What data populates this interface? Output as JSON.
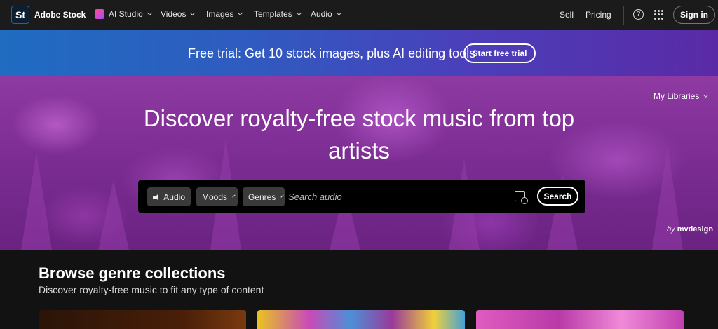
{
  "nav": {
    "logo": "St",
    "brand": "Adobe Stock",
    "items": [
      {
        "label": "AI Studio"
      },
      {
        "label": "Videos"
      },
      {
        "label": "Images"
      },
      {
        "label": "Templates"
      },
      {
        "label": "Audio"
      }
    ],
    "sell": "Sell",
    "pricing": "Pricing",
    "help_symbol": "?",
    "sign_in": "Sign in"
  },
  "promo": {
    "text": "Free trial: Get 10 stock images, plus AI editing tools",
    "button": "Start free trial",
    "gradient": [
      "#1f6cc1",
      "#5a2aa6"
    ]
  },
  "hero": {
    "title": "Discover royalty-free stock music from top artists",
    "my_libraries": "My Libraries",
    "credit_prefix": "by",
    "credit_author": "mvdesign",
    "background_color": "#7b2c92"
  },
  "search": {
    "type_pill": "Audio",
    "moods": "Moods",
    "genres": "Genres",
    "placeholder": "Search audio",
    "button": "Search"
  },
  "browse": {
    "title": "Browse genre collections",
    "subtitle": "Discover royalty-free music to fit any type of content"
  }
}
